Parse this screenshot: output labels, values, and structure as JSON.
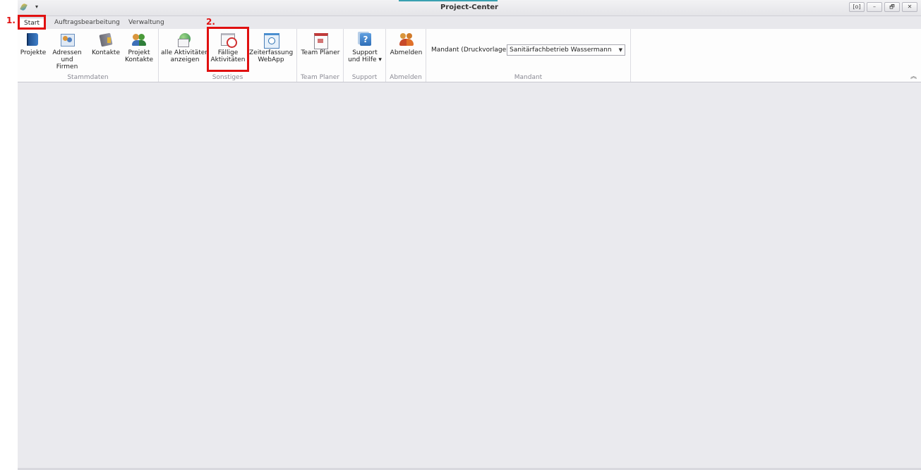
{
  "window": {
    "title": "Project-Center",
    "qat_dropdown_glyph": "▾",
    "controls": {
      "special": "[o]",
      "minimize": "–",
      "restore": "🗗",
      "close": "✕"
    }
  },
  "tabs": [
    "Start",
    "Auftragsbearbeitung",
    "Verwaltung"
  ],
  "ribbon": {
    "groups": {
      "stammdaten": {
        "label": "Stammdaten",
        "buttons": [
          {
            "label": "Projekte",
            "icon": "projects-book-icon"
          },
          {
            "label": "Adressen\nund Firmen",
            "icon": "address-card-icon"
          },
          {
            "label": "Kontakte",
            "icon": "contacts-book-icon"
          },
          {
            "label": "Projekt\nKontakte",
            "icon": "people-icon"
          }
        ]
      },
      "sonstiges": {
        "label": "Sonstiges",
        "buttons": [
          {
            "label": "alle Aktivitäten\nanzeigen",
            "icon": "globe-mail-icon"
          },
          {
            "label": "Fällige\nAktivitäten",
            "icon": "due-calendar-clock-icon"
          },
          {
            "label": "Zeiterfassung\nWebApp",
            "icon": "clock-window-icon"
          }
        ]
      },
      "team_planer": {
        "label": "Team Planer",
        "button": {
          "label": "Team Planer",
          "icon": "calendar-icon"
        }
      },
      "support": {
        "label": "Support",
        "button": {
          "label": "Support\nund Hilfe ▾",
          "icon": "help-icon"
        }
      },
      "abmelden": {
        "label": "Abmelden",
        "button": {
          "label": "Abmelden",
          "icon": "logout-people-icon"
        }
      },
      "mandant": {
        "label": "Mandant",
        "field_label": "Mandant (Druckvorlagen):",
        "selected": "Sanitärfachbetrieb Wassermann"
      }
    },
    "collapse_glyph": "︽"
  },
  "annotations": [
    {
      "number": "1.",
      "target": "Start"
    },
    {
      "number": "2.",
      "target": "Fällige Aktivitäten"
    }
  ],
  "colors": {
    "annotation": "#e01010",
    "workspace": "#eaeaee"
  }
}
